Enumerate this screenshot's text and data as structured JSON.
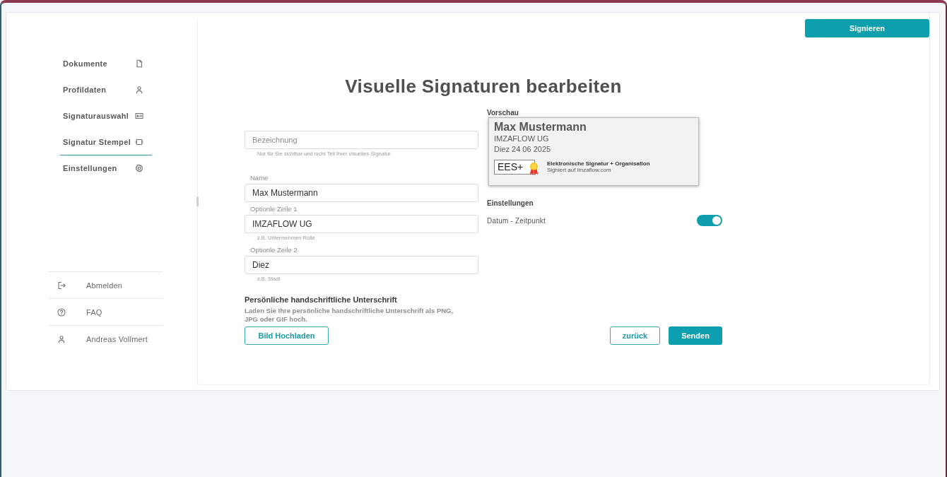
{
  "sidebar": {
    "nav_items": [
      {
        "label": "Dokumente",
        "selected": false
      },
      {
        "label": "Profildaten",
        "selected": false
      },
      {
        "label": "Signaturauswahl",
        "selected": false
      },
      {
        "label": "Signatur Stempel",
        "selected": true
      },
      {
        "label": "Einstellungen",
        "selected": false
      }
    ],
    "footer_items": [
      {
        "label": "Abmelden"
      },
      {
        "label": "FAQ"
      },
      {
        "label": "Andreas Vollmert"
      }
    ]
  },
  "header": {
    "sign_button": "Signieren"
  },
  "title": "Visuelle Signaturen bearbeiten",
  "form": {
    "fields": [
      {
        "placeholder": "Bezeichnung",
        "hint": "Nur für Sie sichtbar und nicht Teil Ihrer visuellen Signatur"
      },
      {
        "label": "Name",
        "value": "Max Mustermann"
      },
      {
        "label": "Optionle Zeile 1",
        "value": "IMZAFLOW UG",
        "hint": "z.B. Untermehmen Rolle"
      },
      {
        "label": "Optionle Zeile 2",
        "value": "Diez",
        "hint": "z.B. Stadt"
      }
    ],
    "upload": {
      "heading": "Persönliche handschriftliche Unterschrift",
      "description": "Laden Sie Ihre persönliche handschriftliche Unterschrift als PNG, JPG oder GIF hoch.",
      "button": "Bild Hochladen"
    }
  },
  "preview": {
    "label": "Vorschau",
    "name": "Max Mustermann",
    "line_1": "IMZAFLOW UG",
    "line_2": "Diez 24 06 2025",
    "badge": "EES+",
    "badge_title": "Elektronische Signatur + Organisation",
    "badge_subtitle": "Signiert auf imzaflow.com"
  },
  "settings": {
    "heading": "Einstellungen",
    "options": [
      {
        "label": "Datum - Zeitpunkt",
        "on": true
      }
    ]
  },
  "actions": {
    "back": "zurück",
    "submit": "Senden"
  }
}
